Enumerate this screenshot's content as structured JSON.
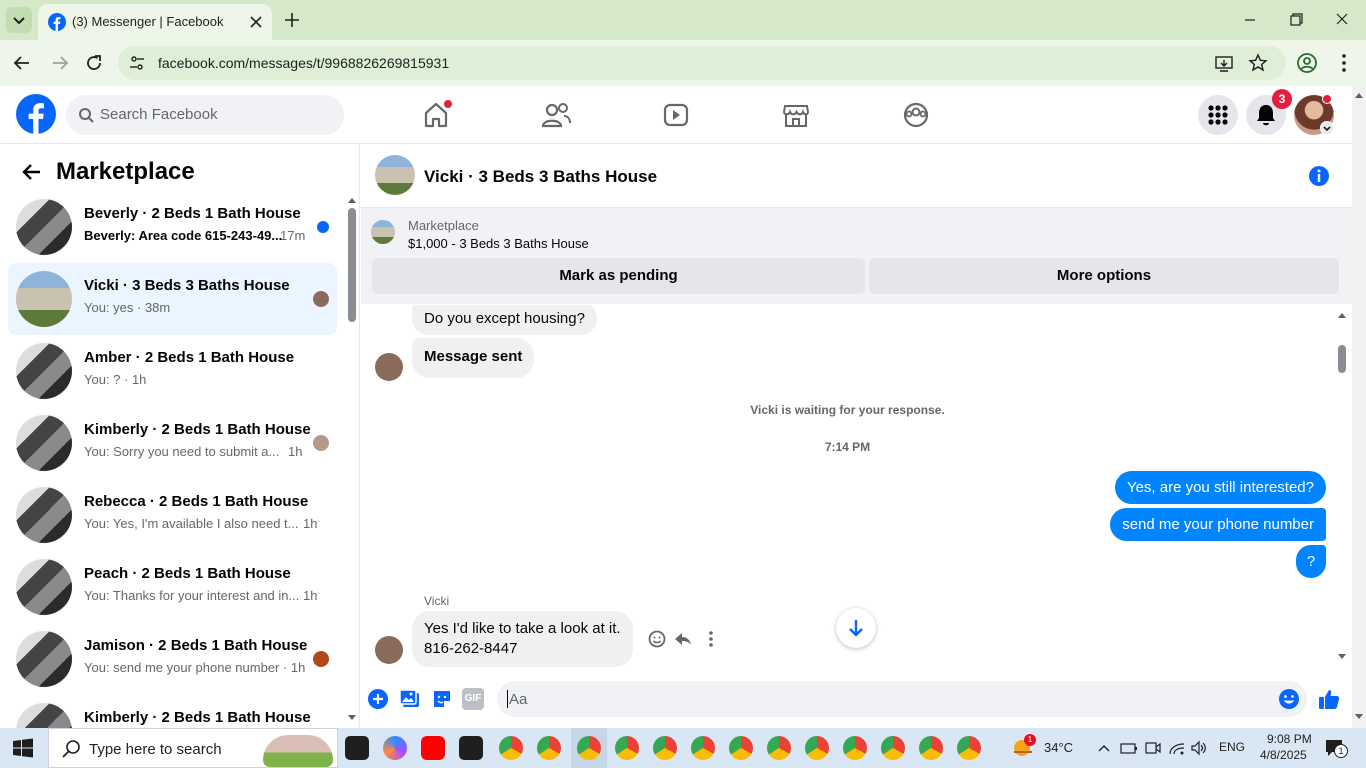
{
  "browser": {
    "tab_title": "(3) Messenger | Facebook",
    "url": "facebook.com/messages/t/9968826269815931"
  },
  "fb": {
    "search_placeholder": "Search Facebook",
    "notifications_count": "3"
  },
  "sidebar": {
    "title": "Marketplace",
    "conversations": [
      {
        "name": "Beverly · 2 Beds 1 Bath House",
        "snippet": "Beverly: Area code 615-243-49...",
        "time": "17m",
        "unread": true
      },
      {
        "name": "Vicki · 3 Beds 3 Baths House",
        "snippet": "You: yes · 38m",
        "time": "",
        "unread": false
      },
      {
        "name": "Amber · 2 Beds 1 Bath House",
        "snippet": "You: ? · 1h",
        "time": "",
        "unread": false
      },
      {
        "name": "Kimberly · 2 Beds 1 Bath House",
        "snippet": "You: Sorry you need to submit a...",
        "time": "1h",
        "unread": false
      },
      {
        "name": "Rebecca · 2 Beds 1 Bath House",
        "snippet": "You: Yes, I'm available I also need t...",
        "time": "1h",
        "unread": false
      },
      {
        "name": "Peach · 2 Beds 1 Bath House",
        "snippet": "You: Thanks for your interest and in...",
        "time": "1h",
        "unread": false
      },
      {
        "name": "Jamison · 2 Beds 1 Bath House",
        "snippet": "You: send me your phone number · 1h",
        "time": "",
        "unread": false
      },
      {
        "name": "Kimberly · 2 Beds 1 Bath House",
        "snippet": "",
        "time": "",
        "unread": false
      }
    ]
  },
  "chat": {
    "title": "Vicki · 3 Beds 3 Baths House",
    "listing_label": "Marketplace",
    "listing_price": "$1,000 - 3 Beds 3 Baths House",
    "mark_pending": "Mark as pending",
    "more_options": "More options",
    "messages": {
      "in1": "Do you except housing?",
      "in2": "Message sent",
      "waiting": "Vicki is waiting for your response.",
      "time": "7:14 PM",
      "out1": "Yes, are you still interested?",
      "out2": "send me your phone number",
      "out3": "?",
      "sender": "Vicki",
      "in3_line1": "Yes I'd like to take a look at it.",
      "in3_line2": "816-262-8447"
    },
    "composer_placeholder": "Aa",
    "gif_label": "GIF"
  },
  "taskbar": {
    "search_placeholder": "Type here to search",
    "temperature": "34°C",
    "language": "ENG",
    "time": "9:08 PM",
    "date": "4/8/2025",
    "notifications": "1",
    "weather_badge": "1"
  },
  "colors": {
    "fb_blue": "#0866ff",
    "messenger_blue": "#0084ff",
    "notif_red": "#e41e3f"
  }
}
